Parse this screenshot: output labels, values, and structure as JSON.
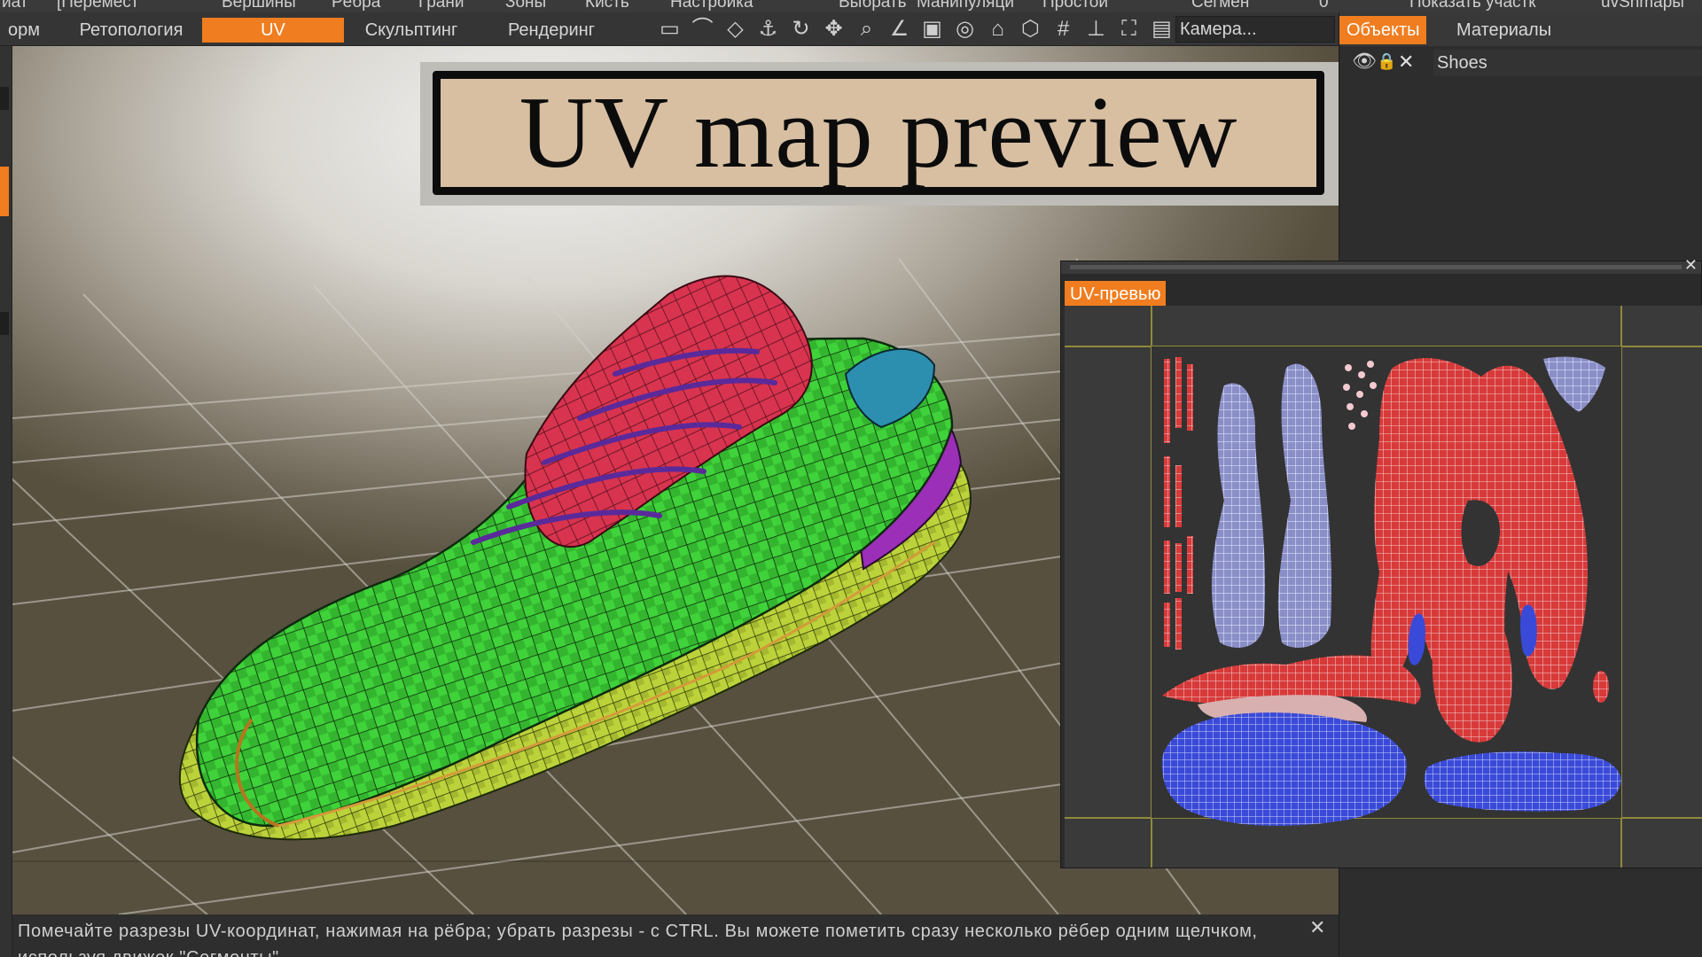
{
  "option_bar": [
    "иат",
    "[Перемест",
    "Вершины",
    "Рёбра",
    "Грани",
    "Зоны",
    "Кисть",
    "Настройка",
    "Выбрать",
    "Манипуляци",
    "Простой",
    "Сегмен",
    "0",
    "Показать участк",
    "uvSnmapы"
  ],
  "tabs": [
    {
      "label": "орм",
      "active": false
    },
    {
      "label": "Ретопология",
      "active": false
    },
    {
      "label": "UV",
      "active": true
    },
    {
      "label": "Скульптинг",
      "active": false
    },
    {
      "label": "Рендеринг",
      "active": false
    }
  ],
  "toolbar_icons": [
    "rect-select-icon",
    "lasso-icon",
    "drop-icon",
    "anchor-icon",
    "rotate-icon",
    "move-icon",
    "zoom-icon",
    "angle-icon",
    "frame-icon",
    "target-icon",
    "home-icon",
    "cube-icon",
    "grid-icon",
    "axis-icon",
    "fullscreen-icon",
    "image-icon"
  ],
  "camera": {
    "value": "Камера..."
  },
  "banner": {
    "title": "UV map preview"
  },
  "right_panel": {
    "tabs": [
      {
        "label": "Объекты",
        "active": true
      },
      {
        "label": "Материалы",
        "active": false
      }
    ],
    "objects": [
      {
        "name": "Shoes"
      }
    ]
  },
  "uv_window": {
    "tab_label": "UV-превью"
  },
  "status": {
    "message": "Помечайте разрезы UV-координат, нажимая на рёбра; убрать разрезы - с CTRL. Вы можете пометить сразу несколько рёбер одним щелчком, используя движок \"Сегменты\""
  },
  "colors": {
    "accent": "#f07d1f",
    "shoe_green": "#3fd23a",
    "tongue_red": "#d8334f",
    "sole_yellow": "#bcd23a",
    "uv_red": "#d83a3a",
    "uv_blue": "#3a4ad8",
    "uv_lavender": "#8a8fc8"
  }
}
